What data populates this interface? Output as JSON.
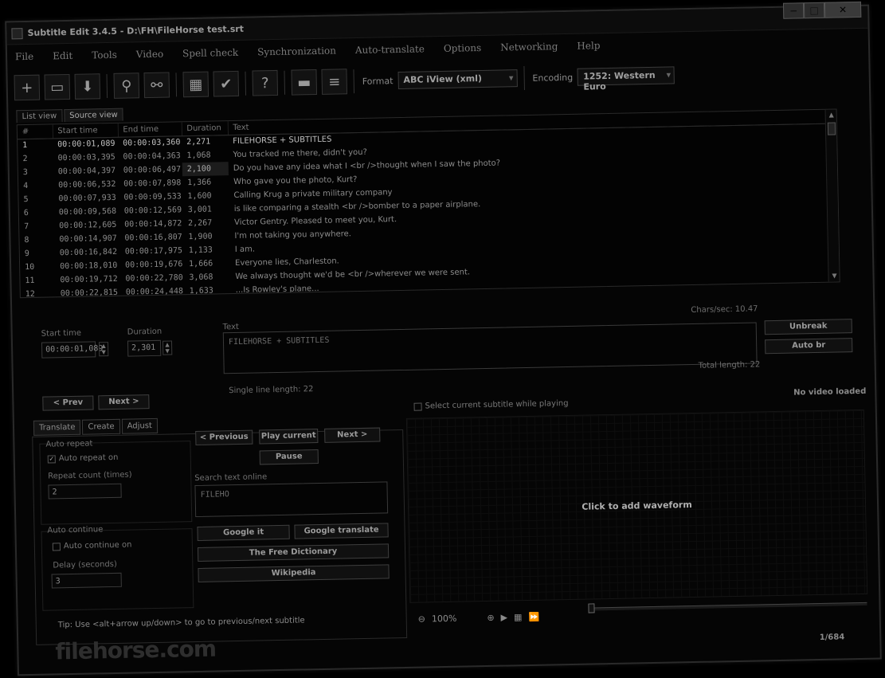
{
  "window": {
    "title": "Subtitle Edit 3.4.5 - D:\\FH\\FileHorse test.srt",
    "minimize": "−",
    "maximize": "□",
    "close": "✕"
  },
  "menu": [
    "File",
    "Edit",
    "Tools",
    "Video",
    "Spell check",
    "Synchronization",
    "Auto-translate",
    "Options",
    "Networking",
    "Help"
  ],
  "toolbar": {
    "format_label": "Format",
    "format_value": "ABC iView (xml)",
    "encoding_label": "Encoding",
    "encoding_value": "1252: Western Euro"
  },
  "view_tabs": [
    "List view",
    "Source view"
  ],
  "grid": {
    "headers": [
      "#",
      "Start time",
      "End time",
      "Duration",
      "Text"
    ],
    "rows": [
      {
        "num": "1",
        "start": "00:00:01,089",
        "end": "00:00:03,360",
        "dur": "2,271",
        "text": "FILEHORSE + SUBTITLES"
      },
      {
        "num": "2",
        "start": "00:00:03,395",
        "end": "00:00:04,363",
        "dur": "1,068",
        "text": "You tracked me there, didn't you?"
      },
      {
        "num": "3",
        "start": "00:00:04,397",
        "end": "00:00:06,497",
        "dur": "2,100",
        "text": "Do you have any idea what I <br />thought when I saw the photo?"
      },
      {
        "num": "4",
        "start": "00:00:06,532",
        "end": "00:00:07,898",
        "dur": "1,366",
        "text": "Who gave you the photo, Kurt?"
      },
      {
        "num": "5",
        "start": "00:00:07,933",
        "end": "00:00:09,533",
        "dur": "1,600",
        "text": "Calling Krug a private military company"
      },
      {
        "num": "6",
        "start": "00:00:09,568",
        "end": "00:00:12,569",
        "dur": "3,001",
        "text": "is like comparing a stealth <br />bomber to a paper airplane."
      },
      {
        "num": "7",
        "start": "00:00:12,605",
        "end": "00:00:14,872",
        "dur": "2,267",
        "text": "Victor Gentry. Pleased to meet you, Kurt."
      },
      {
        "num": "8",
        "start": "00:00:14,907",
        "end": "00:00:16,807",
        "dur": "1,900",
        "text": "I'm not taking you anywhere."
      },
      {
        "num": "9",
        "start": "00:00:16,842",
        "end": "00:00:17,975",
        "dur": "1,133",
        "text": "I am."
      },
      {
        "num": "10",
        "start": "00:00:18,010",
        "end": "00:00:19,676",
        "dur": "1,666",
        "text": "Everyone lies, Charleston."
      },
      {
        "num": "11",
        "start": "00:00:19,712",
        "end": "00:00:22,780",
        "dur": "3,068",
        "text": "We always thought we'd be <br />wherever we were sent."
      },
      {
        "num": "12",
        "start": "00:00:22,815",
        "end": "00:00:24,448",
        "dur": "1,633",
        "text": "...Is Rowley's plane..."
      }
    ]
  },
  "edit": {
    "start_time_label": "Start time",
    "start_time_value": "00:00:01,089",
    "duration_label": "Duration",
    "duration_value": "2,301",
    "text_label": "Text",
    "text_value": "FILEHORSE + SUBTITLES",
    "chars_sec": "Chars/sec: 10.47",
    "unbreak": "Unbreak",
    "auto_br": "Auto br",
    "total_length": "Total length: 22",
    "single_line_length": "Single line length: 22",
    "prev": "< Prev",
    "next": "Next >"
  },
  "bottom_tabs": [
    "Translate",
    "Create",
    "Adjust"
  ],
  "translate": {
    "auto_repeat_group": "Auto repeat",
    "auto_repeat_on": "Auto repeat on",
    "repeat_count_label": "Repeat count (times)",
    "repeat_count_value": "2",
    "auto_continue_group": "Auto continue",
    "auto_continue_on": "Auto continue on",
    "delay_label": "Delay (seconds)",
    "delay_value": "3",
    "previous": "< Previous",
    "play_current": "Play current",
    "next": "Next >",
    "pause": "Pause",
    "search_label": "Search text online",
    "search_value": "FILEHO",
    "google_it": "Google it",
    "google_translate": "Google translate",
    "free_dictionary": "The Free Dictionary",
    "wikipedia": "Wikipedia",
    "tip": "Tip: Use <alt+arrow up/down> to go to previous/next subtitle"
  },
  "video": {
    "select_current": "Select current subtitle while playing",
    "no_video": "No video loaded",
    "click_waveform": "Click to add waveform",
    "zoom": "100%"
  },
  "status": {
    "position": "1/684"
  },
  "watermark": "filehorse.com"
}
